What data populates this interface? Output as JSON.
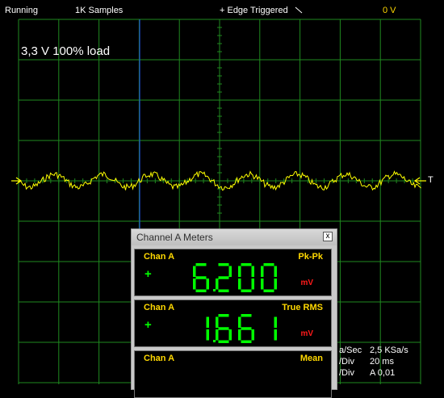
{
  "status_bar": {
    "state": "Running",
    "samples": "1K Samples",
    "trigger": "+ Edge Triggered",
    "trigger_level": "0 V"
  },
  "trace_caption": "3,3 V 100% load",
  "trigger_marker_label": "T",
  "colors": {
    "grid": "#1f8a1f",
    "trace": "#ffff00",
    "cursor": "#1e4fd8",
    "segment": "#00ff00",
    "label": "#ffd800",
    "unit": "#ff1a1a"
  },
  "meter_window": {
    "title": "Channel A Meters",
    "close_glyph": "x",
    "meters": [
      {
        "channel": "Chan A",
        "type": "Pk-Pk",
        "sign": "+",
        "value": "6.200",
        "unit": "mV"
      },
      {
        "channel": "Chan A",
        "type": "True RMS",
        "sign": "+",
        "value": "1.661",
        "unit": "mV"
      },
      {
        "channel": "Chan A",
        "type": "Mean",
        "sign": "",
        "value": "",
        "unit": ""
      }
    ]
  },
  "settings_readout": [
    {
      "key": "a/Sec",
      "value": "2,5 KSa/s"
    },
    {
      "key": "/Div",
      "value": "20 ms"
    },
    {
      "key": "/Div",
      "value": "A 0,01"
    }
  ]
}
